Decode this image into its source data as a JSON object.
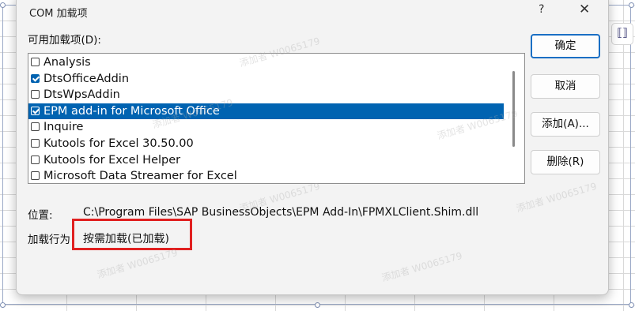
{
  "dialog": {
    "title": "COM 加载项",
    "help_glyph": "?",
    "close_glyph": "✕"
  },
  "available_label": "可用加载项(D):",
  "addins": [
    {
      "label": "Analysis",
      "checked": false,
      "selected": false
    },
    {
      "label": "DtsOfficeAddin",
      "checked": true,
      "selected": false
    },
    {
      "label": "DtsWpsAddin",
      "checked": false,
      "selected": false
    },
    {
      "label": "EPM add-in for Microsoft Office",
      "checked": true,
      "selected": true
    },
    {
      "label": "Inquire",
      "checked": false,
      "selected": false
    },
    {
      "label": "Kutools for Excel 30.50.00",
      "checked": false,
      "selected": false
    },
    {
      "label": "Kutools for Excel Helper",
      "checked": false,
      "selected": false
    },
    {
      "label": "Microsoft Data Streamer for Excel",
      "checked": false,
      "selected": false
    }
  ],
  "buttons": {
    "ok": "确定",
    "cancel": "取消",
    "add": "添加(A)...",
    "remove": "删除(R)"
  },
  "location": {
    "label": "位置:",
    "value": "C:\\Program Files\\SAP BusinessObjects\\EPM Add-In\\FPMXLClient.Shim.dll"
  },
  "load_behavior": {
    "label": "加载行为",
    "value": "按需加载(已加载)"
  },
  "watermark_text": "添加者 W0065179",
  "colors": {
    "selection": "#0063b1",
    "highlight_box": "#e02020",
    "default_button_border": "#1a6fc4"
  }
}
